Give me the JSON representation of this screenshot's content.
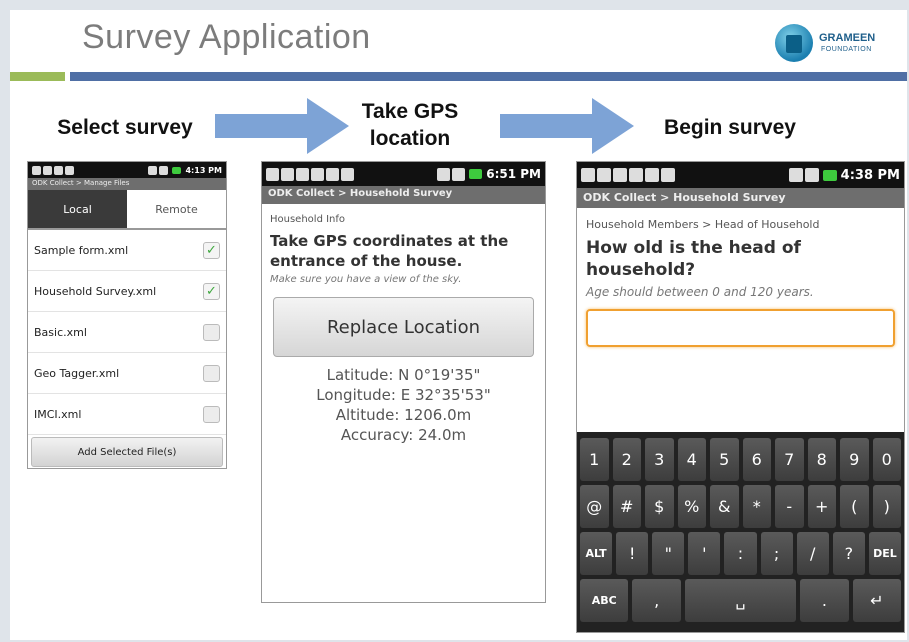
{
  "slide": {
    "title": "Survey Application",
    "logo": {
      "name": "GRAMEEN",
      "sub": "FOUNDATION"
    },
    "steps": [
      "Select survey",
      "Take GPS location",
      "Begin survey"
    ],
    "colors": {
      "green_rule": "#9bbb59",
      "blue_rule": "#4f6fa5",
      "arrow": "#7da3d6",
      "answer_border": "#f0a030",
      "check": "#3fa83f"
    }
  },
  "phone1": {
    "status_time": "4:13 PM",
    "title_bar": "ODK Collect > Manage Files",
    "tabs": {
      "local": "Local",
      "remote": "Remote"
    },
    "files": [
      {
        "name": "Sample form.xml",
        "checked": true
      },
      {
        "name": "Household Survey.xml",
        "checked": true
      },
      {
        "name": "Basic.xml",
        "checked": false
      },
      {
        "name": "Geo Tagger.xml",
        "checked": false
      },
      {
        "name": "IMCI.xml",
        "checked": false
      }
    ],
    "check_glyph": "✓",
    "add_button": "Add Selected File(s)"
  },
  "phone2": {
    "status_time": "6:51 PM",
    "title_bar": "ODK Collect > Household Survey",
    "section": "Household Info",
    "question": "Take GPS coordinates at the entrance of the house.",
    "hint": "Make sure you have a view of the sky.",
    "button": "Replace Location",
    "latitude": "Latitude: N 0°19'35\"",
    "longitude": "Longitude: E 32°35'53\"",
    "altitude": "Altitude: 1206.0m",
    "accuracy": "Accuracy: 24.0m"
  },
  "phone3": {
    "status_time": "4:38 PM",
    "title_bar": "ODK Collect > Household Survey",
    "section": "Household Members > Head of Household",
    "question": "How old is the head of household?",
    "hint": "Age should between 0 and 120 years.",
    "answer_value": "",
    "keyboard": {
      "row1": [
        "1",
        "2",
        "3",
        "4",
        "5",
        "6",
        "7",
        "8",
        "9",
        "0"
      ],
      "row2": [
        "@",
        "#",
        "$",
        "%",
        "&",
        "*",
        "-",
        "+",
        "(",
        ")"
      ],
      "row3": [
        "ALT",
        "!",
        "\"",
        "'",
        ":",
        ";",
        "/",
        "?",
        "DEL"
      ],
      "row4": [
        "ABC",
        ",",
        "␣",
        ".",
        "↵"
      ]
    }
  }
}
